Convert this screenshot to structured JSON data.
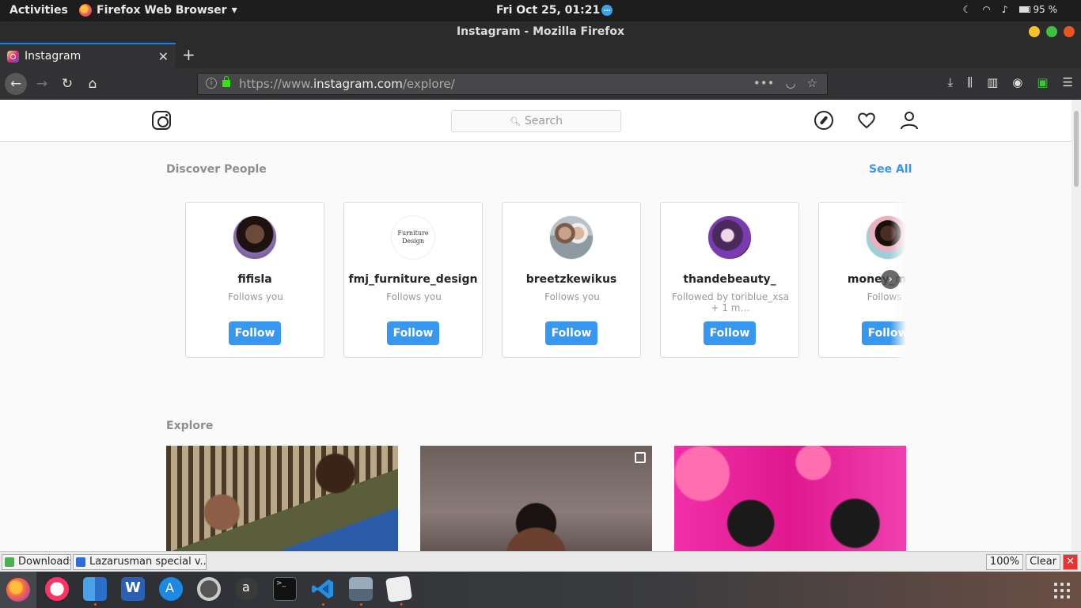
{
  "system": {
    "activities": "Activities",
    "app_menu": "Firefox Web Browser",
    "clock": "Fri Oct 25, 01:21",
    "battery": "95 %"
  },
  "window": {
    "title": "Instagram - Mozilla Firefox"
  },
  "tab": {
    "label": "Instagram"
  },
  "url": {
    "prefix": "https://www.",
    "host": "instagram.com",
    "path": "/explore/"
  },
  "instagram": {
    "search_placeholder": "Search",
    "discover_title": "Discover People",
    "see_all": "See All",
    "explore_title": "Explore",
    "people": [
      {
        "username": "fifisla",
        "sub": "Follows you",
        "button": "Follow"
      },
      {
        "username": "fmj_furniture_design",
        "sub": "Follows you",
        "button": "Follow",
        "logo_line1": "Furniture",
        "logo_line2": "Design"
      },
      {
        "username": "breetzkewikus",
        "sub": "Follows you",
        "button": "Follow"
      },
      {
        "username": "thandebeauty_",
        "sub": "Followed by toriblue_xsa + 1 m…",
        "button": "Follow"
      },
      {
        "username": "money_monc",
        "sub": "Follows y",
        "button": "Follow"
      }
    ]
  },
  "downloads": {
    "item1": "Downloads",
    "item2": "Lazarusman special v...",
    "zoom": "100%",
    "clear": "Clear"
  },
  "colors": {
    "accent": "#3897f0",
    "ubuntu_orange": "#e95420"
  }
}
